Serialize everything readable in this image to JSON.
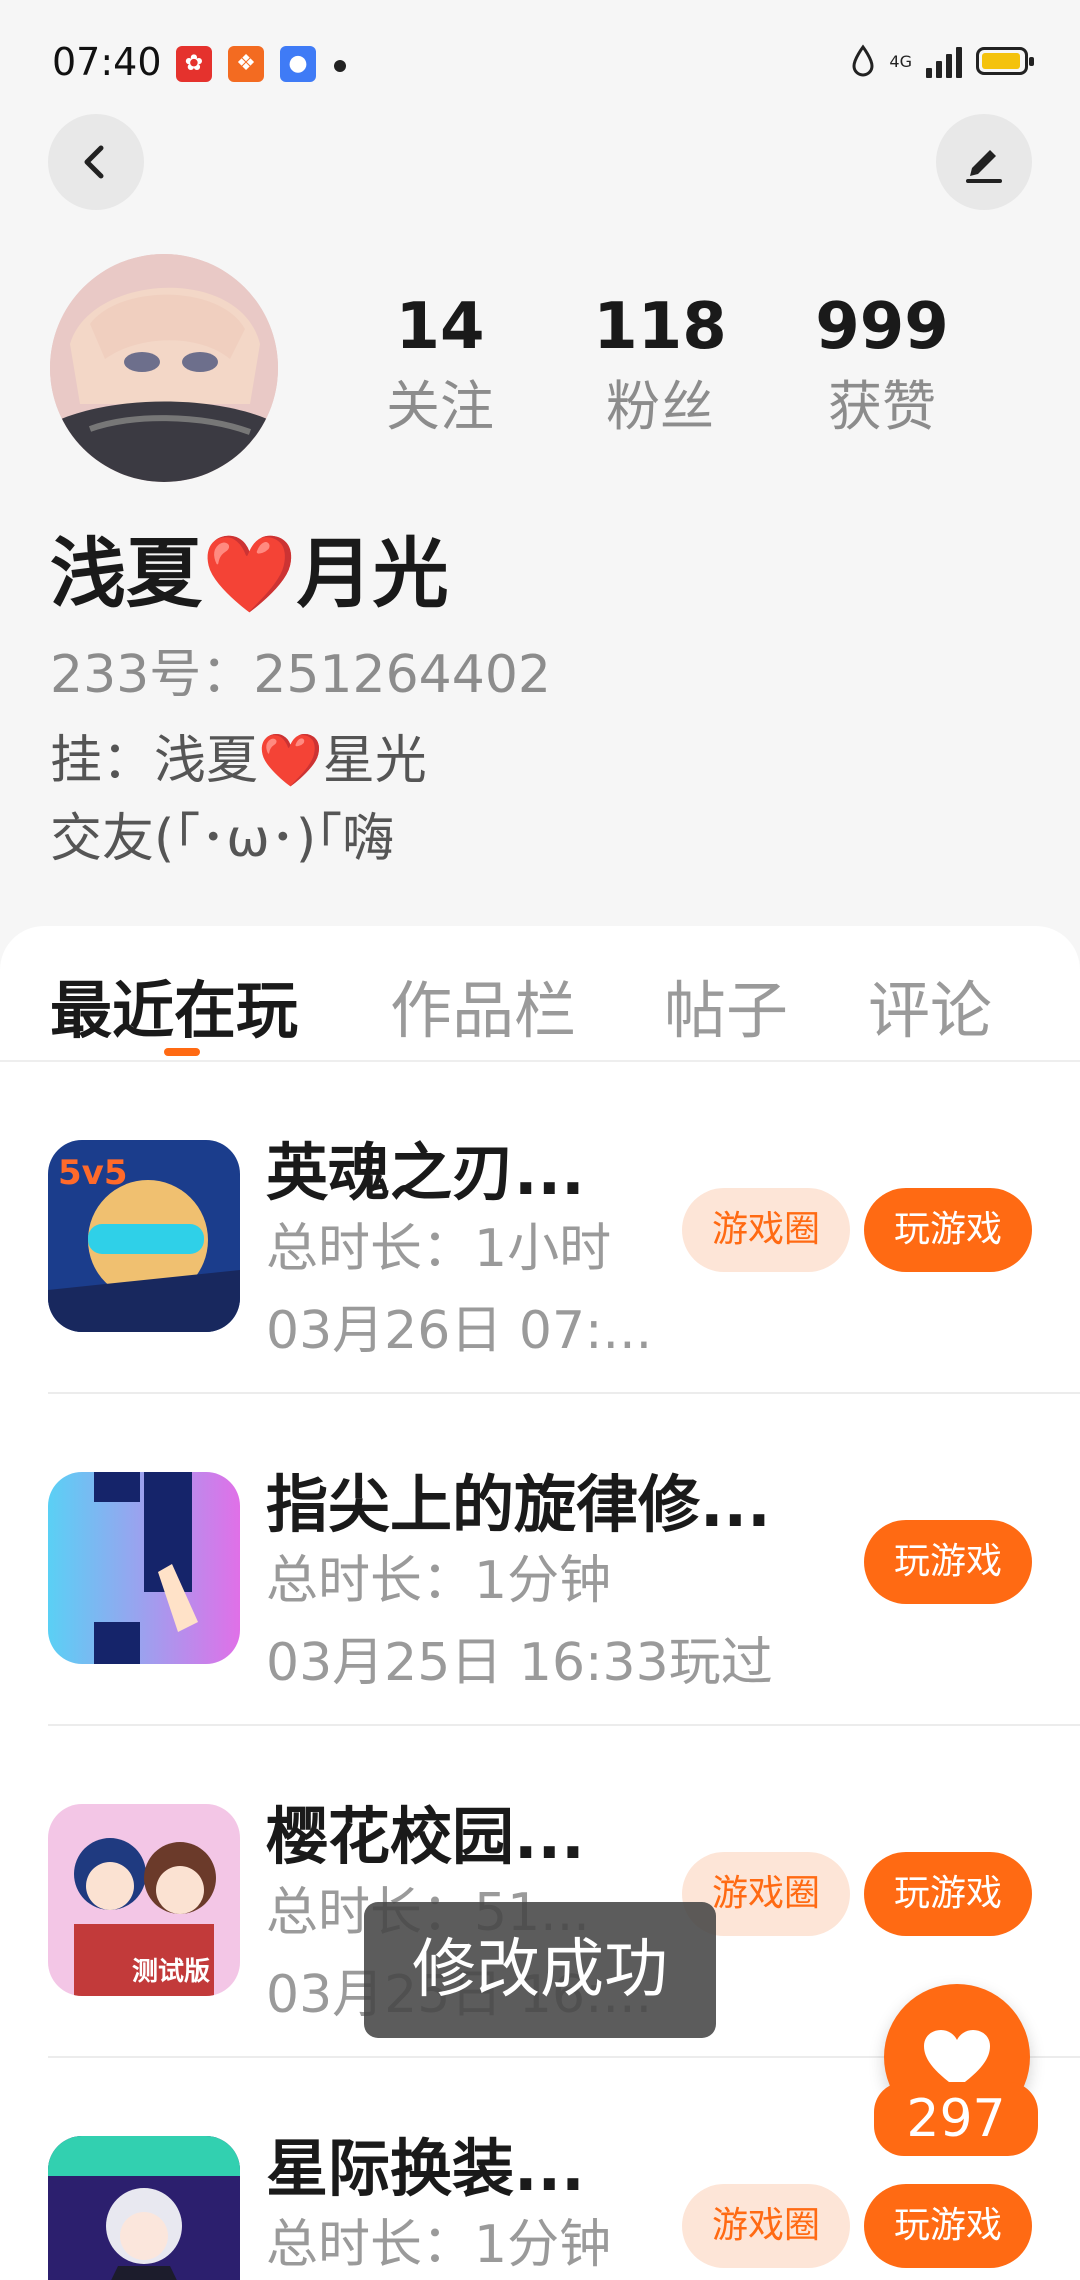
{
  "status_bar": {
    "time": "07:40",
    "network": "4G",
    "app_icons": [
      "app-icon-red",
      "app-icon-orange",
      "app-icon-blue"
    ]
  },
  "profile": {
    "stats": [
      {
        "value": "14",
        "label": "关注"
      },
      {
        "value": "118",
        "label": "粉丝"
      },
      {
        "value": "999",
        "label": "获赞"
      }
    ],
    "nickname": "浅夏❤️月光",
    "id_text": "233号：251264402",
    "bio": "挂：浅夏❤️星光\n交友(｢･ω･)｢嗨"
  },
  "tabs": [
    "最近在玩",
    "作品栏",
    "帖子",
    "评论"
  ],
  "games": [
    {
      "name": "英魂之刃...",
      "duration": "总时长：1小时",
      "played": "03月26日 07:...",
      "circle_label": "游戏圈",
      "play_label": "玩游戏"
    },
    {
      "name": "指尖上的旋律修...",
      "duration": "总时长：1分钟",
      "played": "03月25日 16:33玩过",
      "circle_label": "",
      "play_label": "玩游戏"
    },
    {
      "name": "樱花校园...",
      "duration": "总时长：51...",
      "played": "03月25日 16:...",
      "circle_label": "游戏圈",
      "play_label": "玩游戏"
    },
    {
      "name": "星际换装...",
      "duration": "总时长：1分钟",
      "played": "",
      "circle_label": "游戏圈",
      "play_label": "玩游戏"
    }
  ],
  "toast": "修改成功",
  "like_count": "297",
  "colors": {
    "accent": "#ff6a13",
    "accent_light": "#fde5d7"
  }
}
